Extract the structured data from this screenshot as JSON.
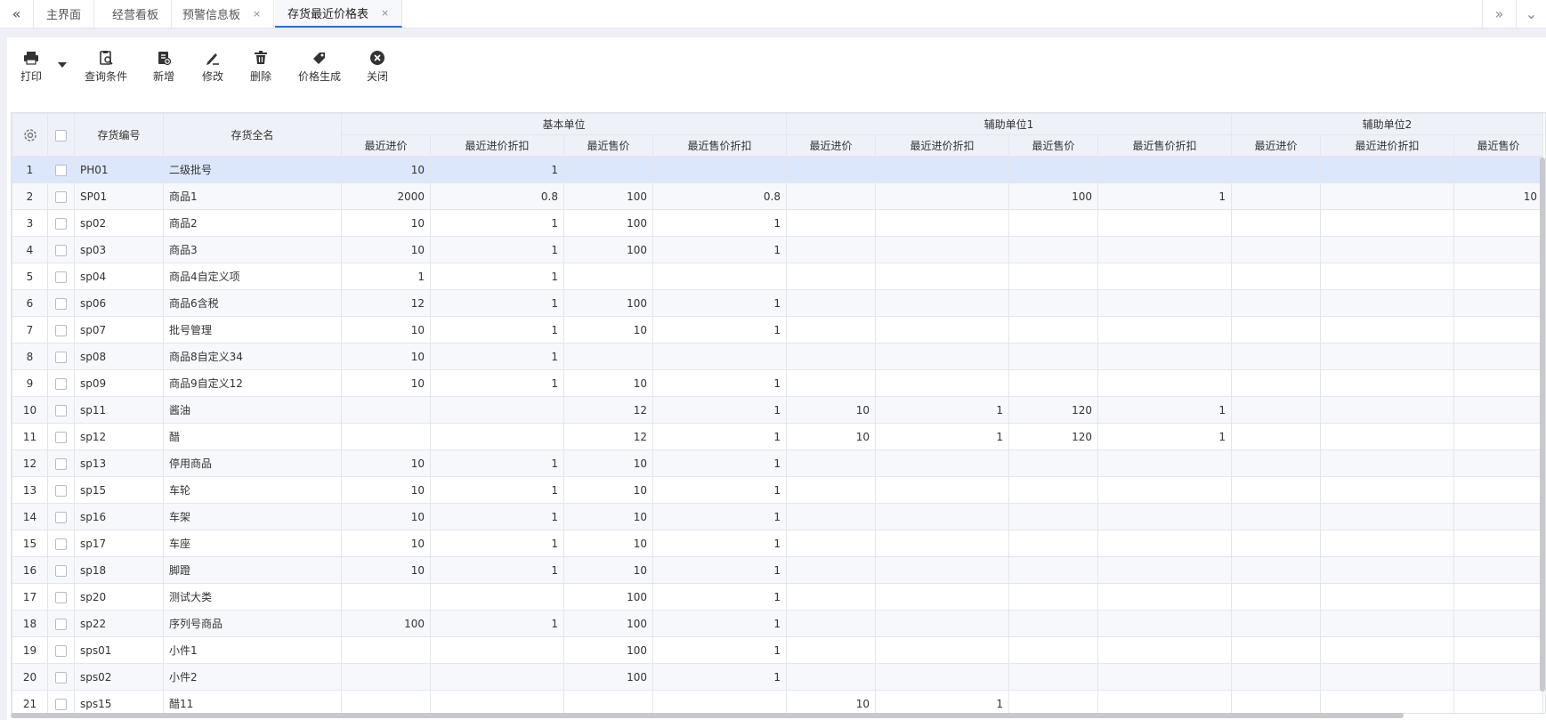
{
  "tabs": [
    {
      "label": "主界面",
      "closable": false,
      "active": false
    },
    {
      "label": "经营看板",
      "closable": false,
      "active": false
    },
    {
      "label": "预警信息板",
      "closable": true,
      "active": false
    },
    {
      "label": "存货最近价格表",
      "closable": true,
      "active": true
    }
  ],
  "nav": {
    "left_icon": "double-chevron-left-icon",
    "right_icon": "double-chevron-right-icon",
    "menu_icon": "chevron-down-icon",
    "close_glyph": "×"
  },
  "toolbar": {
    "print": "打印",
    "query": "查询条件",
    "add": "新增",
    "edit": "修改",
    "delete": "删除",
    "price_gen": "价格生成",
    "close": "关闭"
  },
  "table": {
    "col_code": "存货编号",
    "col_name": "存货全名",
    "groups": [
      "基本单位",
      "辅助单位1",
      "辅助单位2"
    ],
    "sub_cols": [
      "最近进价",
      "最近进价折扣",
      "最近售价",
      "最近售价折扣"
    ],
    "rows": [
      {
        "idx": "1",
        "code": "PH01",
        "name": "二级批号",
        "v": [
          "10",
          "1",
          "",
          "",
          "",
          "",
          "",
          "",
          "",
          "",
          ""
        ]
      },
      {
        "idx": "2",
        "code": "SP01",
        "name": "商品1",
        "v": [
          "2000",
          "0.8",
          "100",
          "0.8",
          "",
          "",
          "100",
          "1",
          "",
          "",
          "10"
        ]
      },
      {
        "idx": "3",
        "code": "sp02",
        "name": "商品2",
        "v": [
          "10",
          "1",
          "100",
          "1",
          "",
          "",
          "",
          "",
          "",
          "",
          ""
        ]
      },
      {
        "idx": "4",
        "code": "sp03",
        "name": "商品3",
        "v": [
          "10",
          "1",
          "100",
          "1",
          "",
          "",
          "",
          "",
          "",
          "",
          ""
        ]
      },
      {
        "idx": "5",
        "code": "sp04",
        "name": "商品4自定义项",
        "v": [
          "1",
          "1",
          "",
          "",
          "",
          "",
          "",
          "",
          "",
          "",
          ""
        ]
      },
      {
        "idx": "6",
        "code": "sp06",
        "name": "商品6含税",
        "v": [
          "12",
          "1",
          "100",
          "1",
          "",
          "",
          "",
          "",
          "",
          "",
          ""
        ]
      },
      {
        "idx": "7",
        "code": "sp07",
        "name": "批号管理",
        "v": [
          "10",
          "1",
          "10",
          "1",
          "",
          "",
          "",
          "",
          "",
          "",
          ""
        ]
      },
      {
        "idx": "8",
        "code": "sp08",
        "name": "商品8自定义34",
        "v": [
          "10",
          "1",
          "",
          "",
          "",
          "",
          "",
          "",
          "",
          "",
          ""
        ]
      },
      {
        "idx": "9",
        "code": "sp09",
        "name": "商品9自定义12",
        "v": [
          "10",
          "1",
          "10",
          "1",
          "",
          "",
          "",
          "",
          "",
          "",
          ""
        ]
      },
      {
        "idx": "10",
        "code": "sp11",
        "name": "酱油",
        "v": [
          "",
          "",
          "12",
          "1",
          "10",
          "1",
          "120",
          "1",
          "",
          "",
          ""
        ]
      },
      {
        "idx": "11",
        "code": "sp12",
        "name": "醋",
        "v": [
          "",
          "",
          "12",
          "1",
          "10",
          "1",
          "120",
          "1",
          "",
          "",
          ""
        ]
      },
      {
        "idx": "12",
        "code": "sp13",
        "name": "停用商品",
        "v": [
          "10",
          "1",
          "10",
          "1",
          "",
          "",
          "",
          "",
          "",
          "",
          ""
        ]
      },
      {
        "idx": "13",
        "code": "sp15",
        "name": "车轮",
        "v": [
          "10",
          "1",
          "10",
          "1",
          "",
          "",
          "",
          "",
          "",
          "",
          ""
        ]
      },
      {
        "idx": "14",
        "code": "sp16",
        "name": "车架",
        "v": [
          "10",
          "1",
          "10",
          "1",
          "",
          "",
          "",
          "",
          "",
          "",
          ""
        ]
      },
      {
        "idx": "15",
        "code": "sp17",
        "name": "车座",
        "v": [
          "10",
          "1",
          "10",
          "1",
          "",
          "",
          "",
          "",
          "",
          "",
          ""
        ]
      },
      {
        "idx": "16",
        "code": "sp18",
        "name": "脚蹬",
        "v": [
          "10",
          "1",
          "10",
          "1",
          "",
          "",
          "",
          "",
          "",
          "",
          ""
        ]
      },
      {
        "idx": "17",
        "code": "sp20",
        "name": "测试大类",
        "v": [
          "",
          "",
          "100",
          "1",
          "",
          "",
          "",
          "",
          "",
          "",
          ""
        ]
      },
      {
        "idx": "18",
        "code": "sp22",
        "name": "序列号商品",
        "v": [
          "100",
          "1",
          "100",
          "1",
          "",
          "",
          "",
          "",
          "",
          "",
          ""
        ]
      },
      {
        "idx": "19",
        "code": "sps01",
        "name": "小件1",
        "v": [
          "",
          "",
          "100",
          "1",
          "",
          "",
          "",
          "",
          "",
          "",
          ""
        ]
      },
      {
        "idx": "20",
        "code": "sps02",
        "name": "小件2",
        "v": [
          "",
          "",
          "100",
          "1",
          "",
          "",
          "",
          "",
          "",
          "",
          ""
        ]
      },
      {
        "idx": "21",
        "code": "sps15",
        "name": "醋11",
        "v": [
          "",
          "",
          "",
          "",
          "10",
          "1",
          "",
          "",
          "",
          "",
          ""
        ]
      }
    ]
  }
}
